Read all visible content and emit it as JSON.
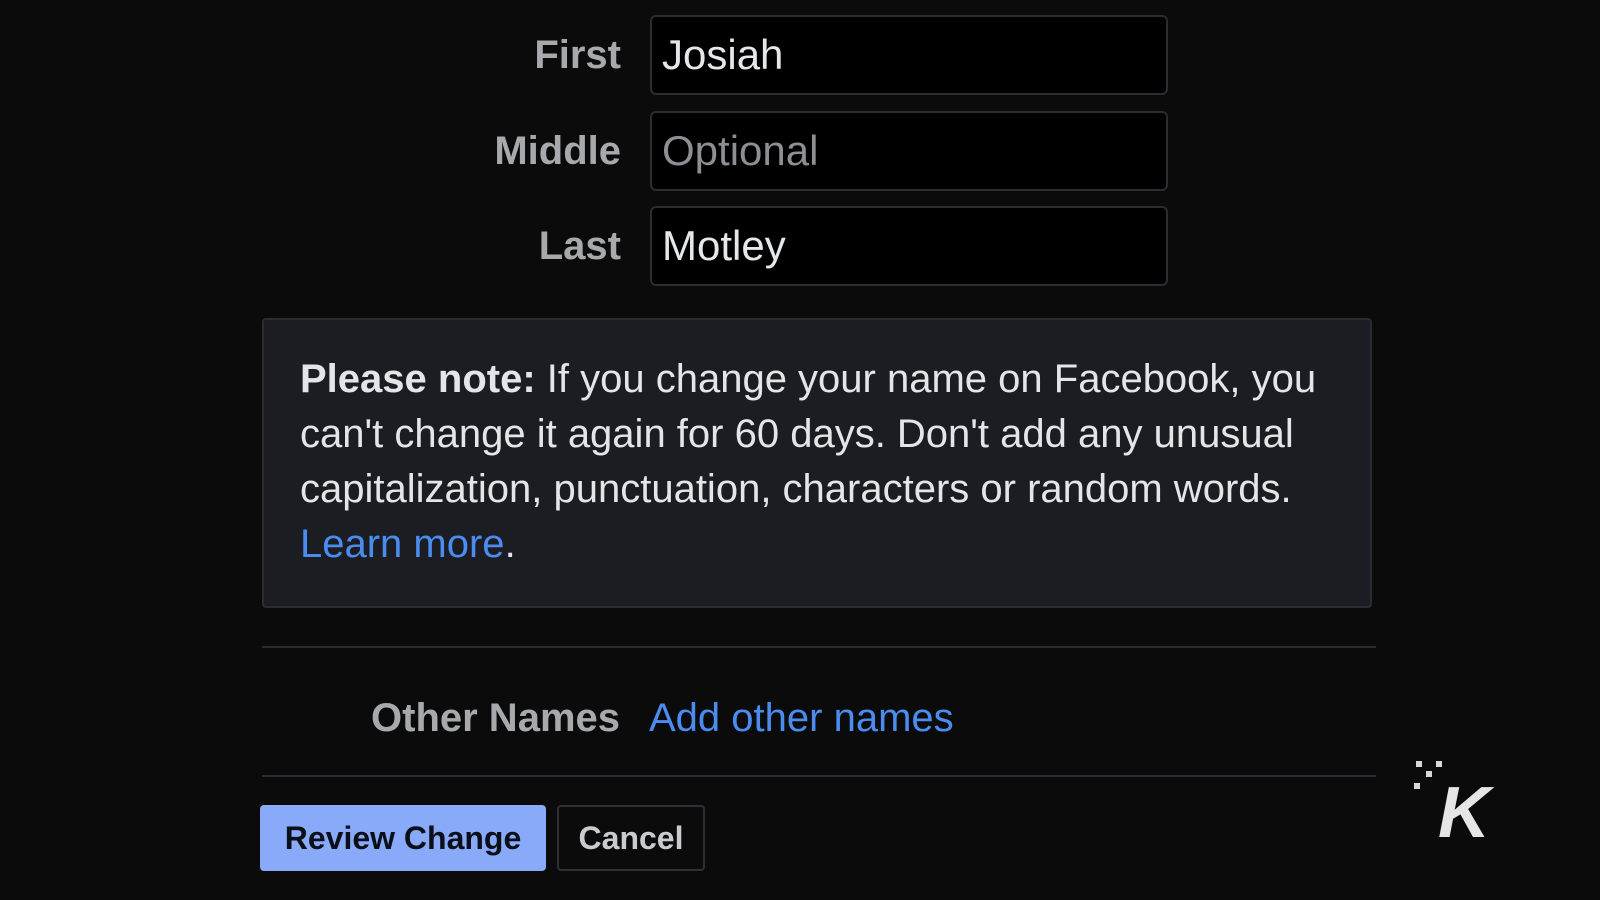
{
  "name_form": {
    "first": {
      "label": "First",
      "value": "Josiah"
    },
    "middle": {
      "label": "Middle",
      "value": "",
      "placeholder": "Optional"
    },
    "last": {
      "label": "Last",
      "value": "Motley"
    }
  },
  "note": {
    "bold": "Please note:",
    "text": " If you change your name on Facebook, you can't change it again for 60 days. Don't add any unusual capitalization, punctuation, characters or random words. ",
    "link": "Learn more",
    "end": "."
  },
  "other_names": {
    "label": "Other Names",
    "link": "Add other names"
  },
  "buttons": {
    "review": "Review Change",
    "cancel": "Cancel"
  },
  "watermark": {
    "letter": "K"
  },
  "colors": {
    "background": "#0b0b0b",
    "link": "#4b8cf0",
    "primary_button": "#88aaf8",
    "note_background": "#1b1d22"
  }
}
